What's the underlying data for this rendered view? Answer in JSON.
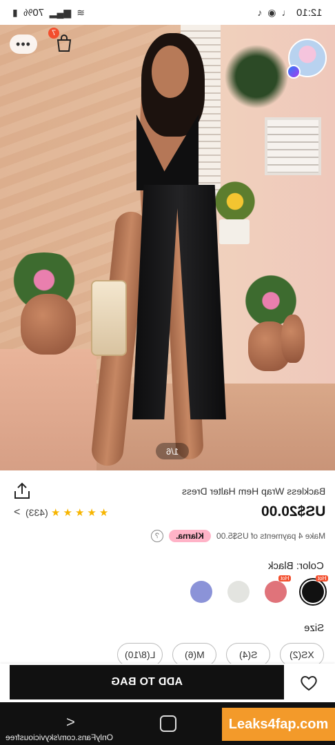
{
  "status_bar": {
    "time": "12:10",
    "battery": "70%"
  },
  "hero": {
    "cart_count": "7",
    "image_counter": "1/6"
  },
  "product": {
    "title": "Backless Wrap Hem Halter Dress",
    "price": "US$20.00",
    "rating_count": "(433)",
    "stars": 5,
    "installments_text": "Make 4 payments of US$5.00",
    "klarna_label": "Klarna.",
    "help_label": "?",
    "color_label": "Color: Black",
    "swatches": [
      {
        "name": "black",
        "color": "#111111",
        "hot": "Hot",
        "selected": true
      },
      {
        "name": "coral",
        "color": "#e0737a",
        "hot": "Hot",
        "selected": false
      },
      {
        "name": "light-grey",
        "color": "#e3e4e0",
        "hot": "",
        "selected": false
      },
      {
        "name": "periwinkle",
        "color": "#8b93d8",
        "hot": "",
        "selected": false
      }
    ],
    "size_label": "Size",
    "sizes": [
      "XS(2)",
      "S(4)",
      "M(6)",
      "L(8/10)"
    ]
  },
  "actions": {
    "add_to_bag": "ADD TO BAG"
  },
  "nav": {
    "watermark_left": "OnlyFans.com/skyviciousfree",
    "watermark_right": "Leaks4fap.com"
  },
  "colors": {
    "accent_black": "#111111",
    "badge_red": "#f34e2d",
    "klarna_pink": "#ffb3c7",
    "star_gold": "#f7b500"
  }
}
